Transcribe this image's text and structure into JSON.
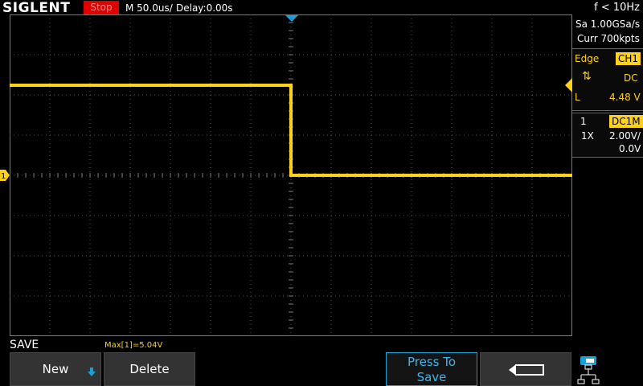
{
  "header": {
    "brand": "SIGLENT",
    "run_state": "Stop",
    "timebase": "M 50.0us/",
    "delay": "Delay:0.00s",
    "frequency": "f < 10Hz"
  },
  "acquisition": {
    "sample_rate": "Sa 1.00GSa/s",
    "memory_depth": "Curr 700kpts"
  },
  "trigger": {
    "type": "Edge",
    "source": "CH1",
    "slope_icon": "rising-falling-edge-icon",
    "coupling": "DC",
    "level_label": "L",
    "level": "4.48 V"
  },
  "channel1": {
    "number": "1",
    "coupling": "DC1M",
    "probe": "1X",
    "scale": "2.00V/",
    "offset": "0.0V",
    "marker": "1",
    "color": "#ffd11a"
  },
  "waveform": {
    "high_level_V": 4.48,
    "low_level_V": 0.0,
    "transition_at_division": 0
  },
  "menu": {
    "title": "SAVE",
    "measurement": "Max[1]=5.04V",
    "new_label": "New",
    "delete_label": "Delete",
    "press_to_save_line1": "Press To",
    "press_to_save_line2": "Save",
    "return_icon": "return-arrow-icon",
    "utility_icon": "network-icon"
  }
}
